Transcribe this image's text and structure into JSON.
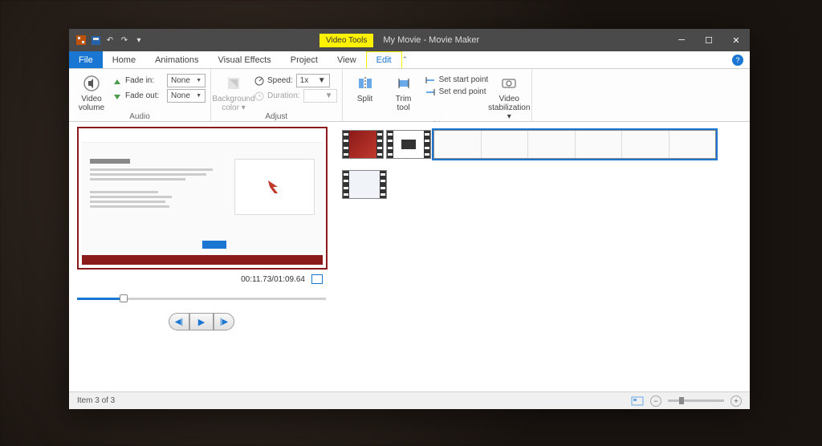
{
  "titlebar": {
    "tools_tab": "Video Tools",
    "title": "My Movie - Movie Maker"
  },
  "tabs": {
    "file": "File",
    "home": "Home",
    "animations": "Animations",
    "visual_effects": "Visual Effects",
    "project": "Project",
    "view": "View",
    "edit": "Edit"
  },
  "ribbon": {
    "audio": {
      "group_label": "Audio",
      "video_volume": "Video\nvolume",
      "fade_in_label": "Fade in:",
      "fade_in_value": "None",
      "fade_out_label": "Fade out:",
      "fade_out_value": "None"
    },
    "adjust": {
      "group_label": "Adjust",
      "bg_color": "Background\ncolor ▾",
      "speed_label": "Speed:",
      "speed_value": "1x",
      "duration_label": "Duration:"
    },
    "editing": {
      "group_label": "Editing",
      "split": "Split",
      "trim": "Trim\ntool",
      "start_point": "Set start point",
      "end_point": "Set end point",
      "stabilization": "Video\nstabilization ▾"
    }
  },
  "preview": {
    "time": "00:11.73/01:09.64"
  },
  "statusbar": {
    "item_text": "Item 3 of 3"
  }
}
